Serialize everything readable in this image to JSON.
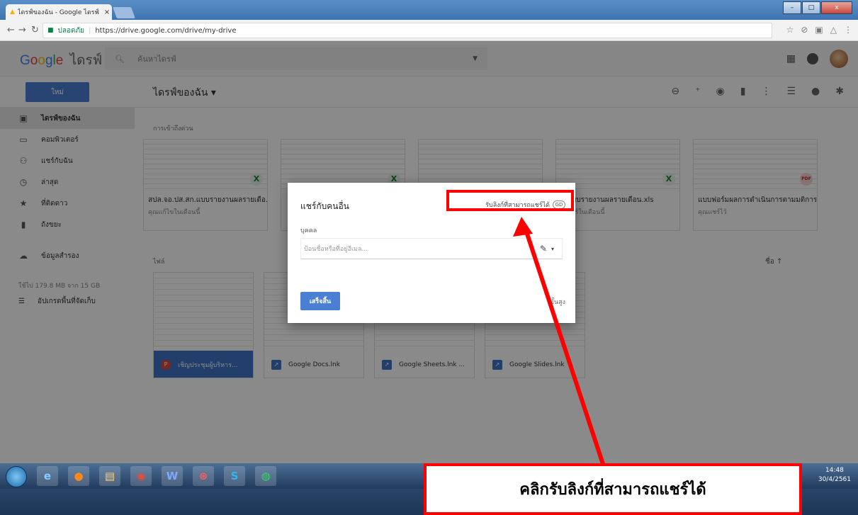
{
  "browser": {
    "tab_title": "ไดรฟ์ของฉัน - Google ไดรฟ์",
    "tab_close": "×",
    "secure_label": "ปลอดภัย",
    "url": "https://drive.google.com/drive/my-drive",
    "win_min": "–",
    "win_max": "□",
    "win_close": "x"
  },
  "drive": {
    "logo_google": [
      "G",
      "o",
      "o",
      "g",
      "l",
      "e"
    ],
    "logo_drive": "ไดรฟ์",
    "search_placeholder": "ค้นหาไดรฟ์",
    "new_button": "ใหม่",
    "breadcrumb": "ไดรฟ์ของฉัน ▾",
    "sidebar": [
      {
        "label": "ไดรฟ์ของฉัน",
        "icon": "drive-icon"
      },
      {
        "label": "คอมพิวเตอร์",
        "icon": "computer-icon"
      },
      {
        "label": "แชร์กับฉัน",
        "icon": "people-icon"
      },
      {
        "label": "ล่าสุด",
        "icon": "clock-icon"
      },
      {
        "label": "ที่ติดดาว",
        "icon": "star-icon"
      },
      {
        "label": "ถังขยะ",
        "icon": "trash-icon"
      },
      {
        "label": "ข้อมูลสำรอง",
        "icon": "cloud-icon"
      }
    ],
    "storage_text": "ใช้ไป 179.8 MB จาก 15 GB",
    "upgrade_label": "อัปเกรดพื้นที่จัดเก็บ",
    "quick_access_label": "การเข้าถึงด่วน",
    "files_label": "ไฟล์",
    "sort_label": "ชื่อ",
    "quick_cards": [
      {
        "name": "สปล.จอ.ปส.สก.แบบรายงานผลรายเดือ...",
        "sub": "คุณแก้ไขในเดือนนี้",
        "type": "xls"
      },
      {
        "name": "",
        "sub": "",
        "type": "xls"
      },
      {
        "name": "",
        "sub": "",
        "type": "xls"
      },
      {
        "name": "...แบบรายงานผลรายเดือน.xls",
        "sub": "...แชร์ในเดือนนี้",
        "type": "xls"
      },
      {
        "name": "แบบฟอร์มผลการดำเนินการตามมติการ...",
        "sub": "คุณแชร์ไว้",
        "type": "pdf"
      }
    ],
    "files": [
      {
        "name": "เชิญประชุมผู้บริหาร...",
        "type": "pdf"
      },
      {
        "name": "Google Docs.lnk",
        "type": "lnk"
      },
      {
        "name": "Google Sheets.lnk ...",
        "type": "lnk"
      },
      {
        "name": "Google Slides.lnk",
        "type": "lnk"
      }
    ]
  },
  "dialog": {
    "title": "แชร์กับคนอื่น",
    "get_link": "รับลิงก์ที่สามารถแชร์ได้",
    "link_icon": "GD",
    "people_label": "บุคคล",
    "input_placeholder": "ป้อนชื่อหรือที่อยู่อีเมล...",
    "done_button": "เสร็จสิ้น",
    "advanced": "ขั้นสูง"
  },
  "annotation": {
    "callout_text": "คลิกรับลิงก์ที่สามารถแชร์ได้",
    "color": "#ff0000"
  },
  "taskbar": {
    "apps": [
      "ie-icon",
      "firefox-icon",
      "explorer-icon",
      "chrome-icon",
      "word-icon",
      "app-icon",
      "skype-icon",
      "line-icon"
    ],
    "time": "14:48",
    "date": "30/4/2561"
  }
}
